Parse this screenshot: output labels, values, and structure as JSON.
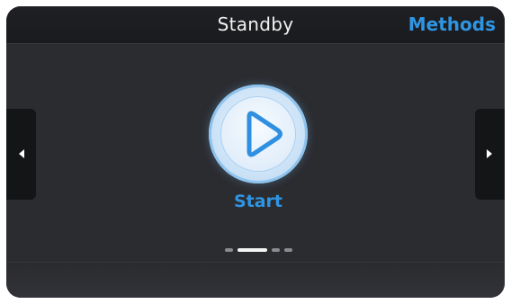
{
  "header": {
    "title": "Standby",
    "methods_label": "Methods"
  },
  "nav": {
    "left_icon": "triangle-left",
    "right_icon": "triangle-right"
  },
  "main": {
    "start_icon": "play-icon",
    "start_label": "Start"
  },
  "pager": {
    "count": 4,
    "active_index": 1
  },
  "colors": {
    "accent": "#2f95e3",
    "background": "#2b2c30",
    "header": "#1f2023"
  }
}
